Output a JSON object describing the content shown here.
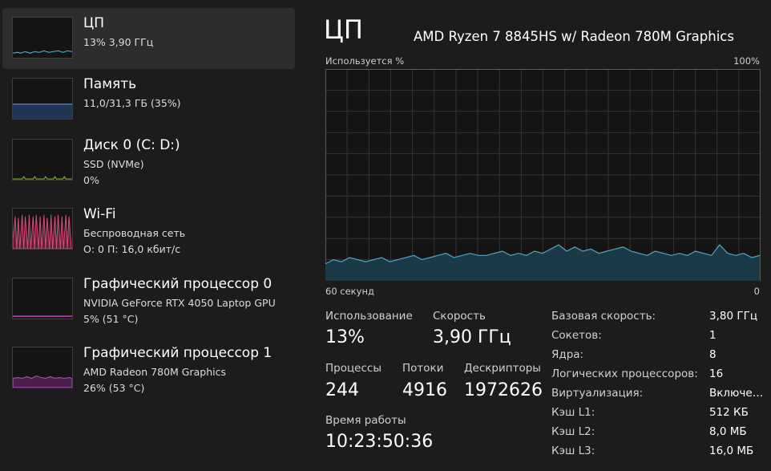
{
  "colors": {
    "background": "#1c1c1c",
    "selected": "#2d2d2d",
    "cpu": "#4fa5c7",
    "memory": "#4a78c0",
    "disk": "#7fa838",
    "wifi": "#d84c7c",
    "gpu0": "#c341b7",
    "gpu1": "#a64db0"
  },
  "sidebar": {
    "items": [
      {
        "title": "ЦП",
        "line1": "13%  3,90 ГГц",
        "line2": ""
      },
      {
        "title": "Память",
        "line1": "11,0/31,3 ГБ (35%)",
        "line2": ""
      },
      {
        "title": "Диск 0 (C: D:)",
        "line1": "SSD (NVMe)",
        "line2": "0%"
      },
      {
        "title": "Wi-Fi",
        "line1": "Беспроводная сеть",
        "line2": "О: 0  П: 16,0 кбит/с"
      },
      {
        "title": "Графический процессор 0",
        "line1": "NVIDIA GeForce RTX 4050 Laptop GPU",
        "line2": "5%  (51 °C)"
      },
      {
        "title": "Графический процессор 1",
        "line1": "AMD Radeon 780M Graphics",
        "line2": "26%  (53 °C)"
      }
    ]
  },
  "main": {
    "title": "ЦП",
    "cpu_model": "AMD Ryzen 7 8845HS w/ Radeon 780M Graphics",
    "graph": {
      "label_y": "Используется %",
      "label_max": "100%",
      "label_time": "60 секунд",
      "label_zero": "0",
      "values": [
        8,
        10,
        9,
        11,
        10,
        9,
        10,
        11,
        9,
        10,
        11,
        12,
        10,
        11,
        12,
        13,
        11,
        12,
        13,
        12,
        12,
        13,
        14,
        12,
        13,
        12,
        14,
        13,
        15,
        17,
        14,
        16,
        14,
        15,
        13,
        14,
        15,
        16,
        14,
        13,
        12,
        14,
        13,
        12,
        13,
        12,
        14,
        13,
        12,
        17,
        13,
        12,
        13,
        11,
        12
      ]
    },
    "stats": {
      "usage_label": "Использование",
      "usage": "13%",
      "speed_label": "Скорость",
      "speed": "3,90 ГГц",
      "processes_label": "Процессы",
      "processes": "244",
      "threads_label": "Потоки",
      "threads": "4916",
      "handles_label": "Дескрипторы",
      "handles": "1972626",
      "uptime_label": "Время работы",
      "uptime": "10:23:50:36"
    },
    "specs": [
      {
        "label": "Базовая скорость:",
        "value": "3,80 ГГц"
      },
      {
        "label": "Сокетов:",
        "value": "1"
      },
      {
        "label": "Ядра:",
        "value": "8"
      },
      {
        "label": "Логических процессоров:",
        "value": "16"
      },
      {
        "label": "Виртуализация:",
        "value": "Включе…"
      },
      {
        "label": "Кэш L1:",
        "value": "512 КБ"
      },
      {
        "label": "Кэш L2:",
        "value": "8,0 МБ"
      },
      {
        "label": "Кэш L3:",
        "value": "16,0 МБ"
      }
    ]
  }
}
